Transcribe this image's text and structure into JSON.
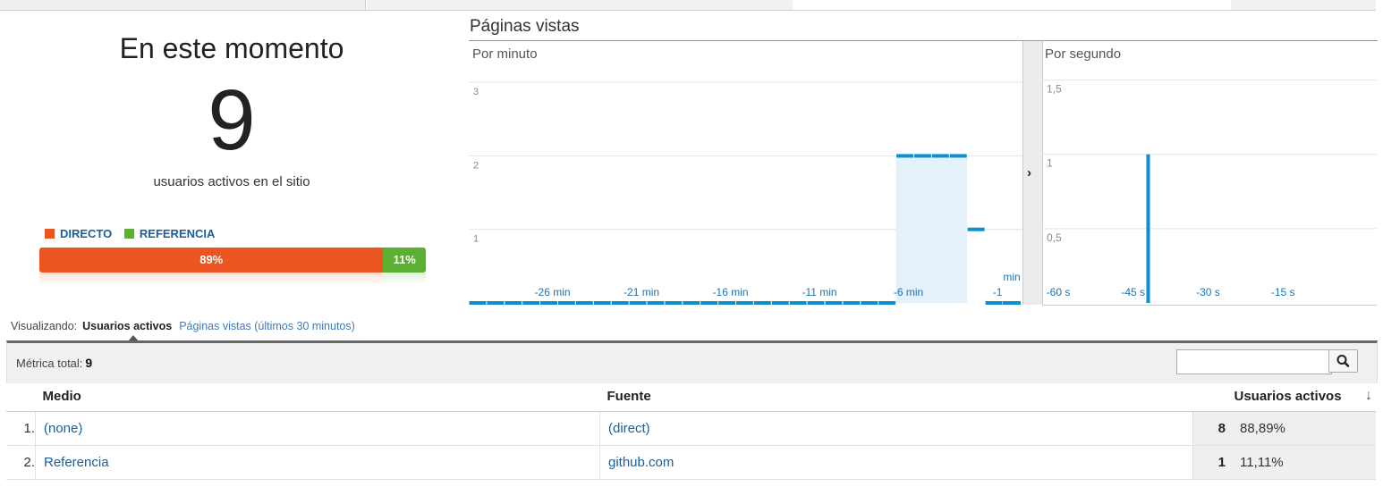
{
  "summary": {
    "title": "En este momento",
    "count": "9",
    "subtitle": "usuarios activos en el sitio",
    "legend": [
      {
        "label": "DIRECTO",
        "color": "#ea5520"
      },
      {
        "label": "REFERENCIA",
        "color": "#5bb032"
      }
    ],
    "segments": [
      {
        "label": "89%",
        "value": 89,
        "color": "#ea5520"
      },
      {
        "label": "11%",
        "value": 11,
        "color": "#5bb032"
      }
    ]
  },
  "chart": {
    "title": "Páginas vistas",
    "minute_label": "Por minuto",
    "second_label": "Por segundo",
    "toggle_glyph": "›"
  },
  "chart_data": [
    {
      "type": "bar",
      "title": "Por minuto",
      "ylim": [
        0,
        3.5
      ],
      "yticks": [
        "1",
        "2",
        "3"
      ],
      "xtick_labels": [
        "-26 min",
        "-21 min",
        "-16 min",
        "-11 min",
        "-6 min",
        "-1"
      ],
      "xtick_label_extra": "min",
      "bar_color": "#0c8fcc",
      "x": [
        -30,
        -29,
        -28,
        -27,
        -26,
        -25,
        -24,
        -23,
        -22,
        -21,
        -20,
        -19,
        -18,
        -17,
        -16,
        -15,
        -14,
        -13,
        -12,
        -11,
        -10,
        -9,
        -8,
        -7,
        -6,
        -5,
        -4,
        -3,
        -2,
        -1
      ],
      "values": [
        0,
        0,
        0,
        0,
        0,
        0,
        0,
        0,
        0,
        0,
        0,
        0,
        0,
        0,
        0,
        0,
        0,
        0,
        0,
        0,
        0,
        0,
        0,
        0,
        2,
        2,
        2,
        2,
        1,
        0
      ],
      "highlight_range": [
        -6,
        -3
      ]
    },
    {
      "type": "bar",
      "title": "Por segundo",
      "ylim": [
        0,
        1.75
      ],
      "yticks": [
        "0,5",
        "1",
        "1,5"
      ],
      "xtick_labels": [
        "-60 s",
        "-45 s",
        "-30 s",
        "-15 s"
      ],
      "bar_color": "#0c8fcc",
      "spikes": [
        {
          "x": -42,
          "value": 1
        }
      ]
    }
  ],
  "viewing": {
    "prefix": "Visualizando:",
    "selected": "Usuarios activos",
    "other": "Páginas vistas (últimos 30 minutos)"
  },
  "table": {
    "total_label": "Métrica total:",
    "total_value": "9",
    "search_placeholder": "",
    "columns": [
      "Medio",
      "Fuente",
      "Usuarios activos"
    ],
    "sort_glyph": "↓",
    "rows": [
      {
        "n": "1.",
        "medio": "(none)",
        "fuente": "(direct)",
        "value": "8",
        "pct": "88,89%"
      },
      {
        "n": "2.",
        "medio": "Referencia",
        "fuente": "github.com",
        "value": "1",
        "pct": "11,11%"
      }
    ]
  }
}
